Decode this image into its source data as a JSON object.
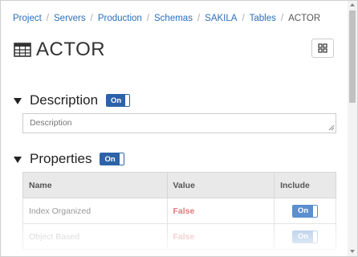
{
  "breadcrumb": [
    {
      "label": "Project"
    },
    {
      "label": "Servers"
    },
    {
      "label": "Production"
    },
    {
      "label": "Schemas"
    },
    {
      "label": "SAKILA"
    },
    {
      "label": "Tables"
    }
  ],
  "breadcrumb_current": "ACTOR",
  "page": {
    "title": "ACTOR"
  },
  "description": {
    "title": "Description",
    "toggle_label": "On",
    "placeholder": "Description"
  },
  "properties": {
    "title": "Properties",
    "toggle_label": "On",
    "columns": [
      "Name",
      "Value",
      "Include"
    ],
    "rows": [
      {
        "name": "Index Organized",
        "value": "False",
        "include": "On"
      },
      {
        "name": "Object Based",
        "value": "False",
        "include": "On"
      }
    ]
  },
  "colors": {
    "accent": "#2c63a8",
    "false_value": "#e07b7b",
    "link": "#2a6ebb"
  }
}
